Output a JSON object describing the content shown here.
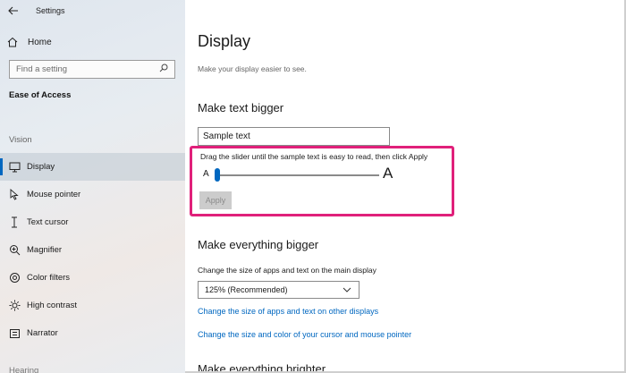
{
  "window": {
    "title": "Settings"
  },
  "sidebar": {
    "home_label": "Home",
    "search_placeholder": "Find a setting",
    "section_title": "Ease of Access",
    "group_title": "Vision",
    "items": [
      {
        "label": "Display",
        "icon": "monitor-icon",
        "active": true
      },
      {
        "label": "Mouse pointer",
        "icon": "mouse-pointer-icon",
        "active": false
      },
      {
        "label": "Text cursor",
        "icon": "text-cursor-icon",
        "active": false
      },
      {
        "label": "Magnifier",
        "icon": "magnifier-icon",
        "active": false
      },
      {
        "label": "Color filters",
        "icon": "color-filters-icon",
        "active": false
      },
      {
        "label": "High contrast",
        "icon": "high-contrast-icon",
        "active": false
      },
      {
        "label": "Narrator",
        "icon": "narrator-icon",
        "active": false
      }
    ],
    "cut_label": "Hearing"
  },
  "main": {
    "title": "Display",
    "subtitle": "Make your display easier to see.",
    "text_bigger": {
      "heading": "Make text bigger",
      "sample_text": "Sample text",
      "instruction": "Drag the slider until the sample text is easy to read, then click Apply",
      "small_a": "A",
      "big_a": "A",
      "slider_value_percent": 100,
      "apply_label": "Apply"
    },
    "everything_bigger": {
      "heading": "Make everything bigger",
      "description": "Change the size of apps and text on the main display",
      "scale_selected": "125% (Recommended)",
      "link_other_displays": "Change the size of apps and text on other displays",
      "link_cursor": "Change the size and color of your cursor and mouse pointer"
    },
    "brighter_heading": "Make everything brighter"
  },
  "colors": {
    "accent": "#0067c0",
    "highlight_border": "#e0207a"
  }
}
